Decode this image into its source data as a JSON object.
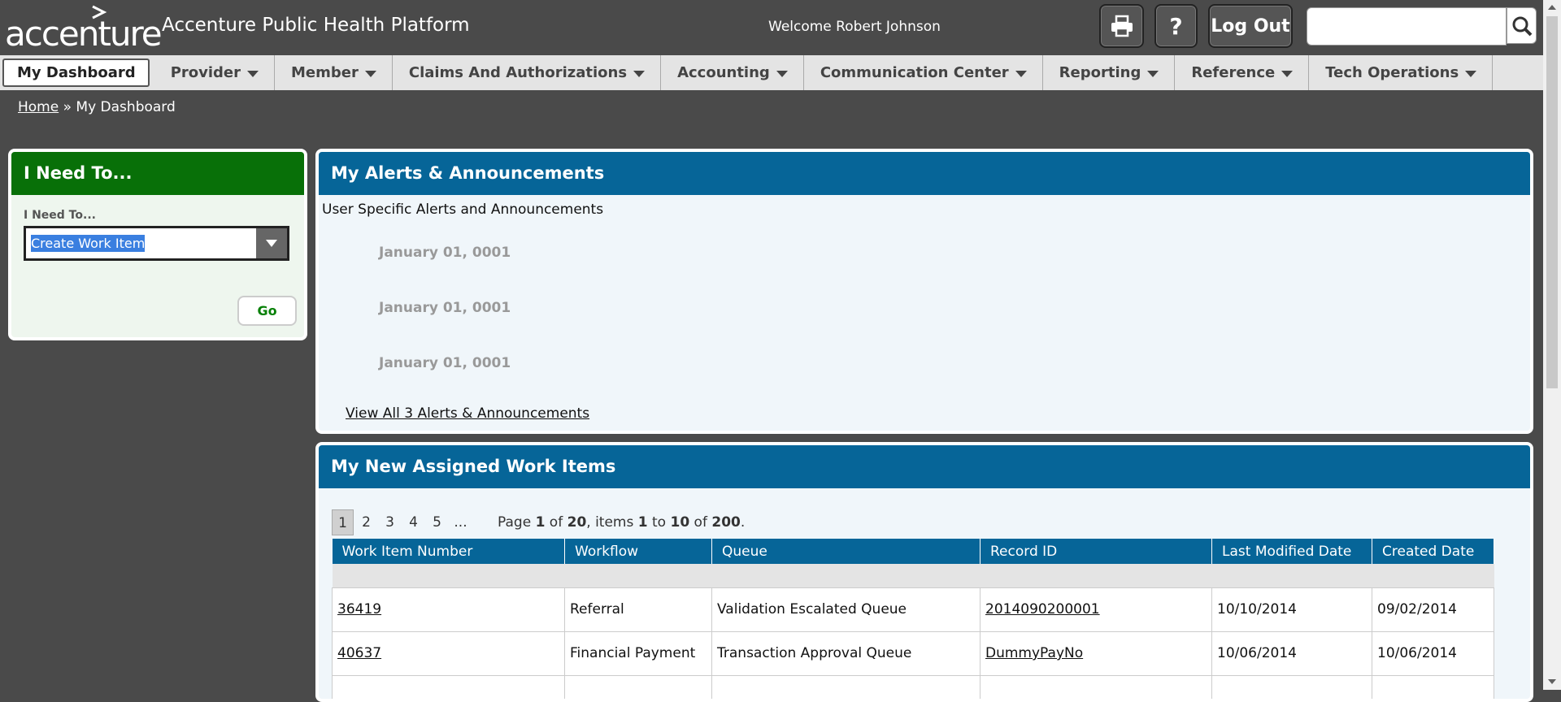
{
  "header": {
    "logo_text": "accenture",
    "app_title": "Accenture Public Health Platform",
    "welcome": "Welcome Robert Johnson",
    "print_icon": "printer-icon",
    "help_label": "?",
    "logout_label": "Log Out",
    "search_placeholder": "",
    "search_icon": "search-icon"
  },
  "nav": {
    "items": [
      {
        "label": "My Dashboard",
        "dropdown": false
      },
      {
        "label": "Provider",
        "dropdown": true
      },
      {
        "label": "Member",
        "dropdown": true
      },
      {
        "label": "Claims And Authorizations",
        "dropdown": true
      },
      {
        "label": "Accounting",
        "dropdown": true
      },
      {
        "label": "Communication Center",
        "dropdown": true
      },
      {
        "label": "Reporting",
        "dropdown": true
      },
      {
        "label": "Reference",
        "dropdown": true
      },
      {
        "label": "Tech Operations",
        "dropdown": true
      }
    ]
  },
  "breadcrumb": {
    "home": "Home",
    "separator": "»",
    "current": "My Dashboard"
  },
  "need_to": {
    "title": "I Need To...",
    "field_label": "I Need To...",
    "selected": "Create Work Item",
    "go_label": "Go",
    "colors": {
      "header": "#087008"
    }
  },
  "alerts": {
    "title": "My Alerts & Announcements",
    "subtitle": "User Specific Alerts and Announcements",
    "dates": [
      "January 01, 0001",
      "January 01, 0001",
      "January 01, 0001"
    ],
    "view_all": "View All 3 Alerts & Announcements",
    "colors": {
      "header": "#066598"
    }
  },
  "work_items": {
    "title": "My New Assigned Work Items",
    "pages": [
      "1",
      "2",
      "3",
      "4",
      "5",
      "..."
    ],
    "current_page": "1",
    "page_info": {
      "prefix": "Page ",
      "page": "1",
      "of1": " of ",
      "total_pages": "20",
      "items": ", items ",
      "from": "1",
      "to_word": " to ",
      "to": "10",
      "of2": " of ",
      "total_items": "200",
      "suffix": "."
    },
    "columns": [
      "Work Item Number",
      "Workflow",
      "Queue",
      "Record ID",
      "Last Modified Date",
      "Created Date"
    ],
    "rows": [
      [
        "36419",
        "Referral",
        "Validation Escalated Queue",
        "2014090200001",
        "10/10/2014",
        "09/02/2014"
      ],
      [
        "40637",
        "Financial Payment",
        "Transaction Approval Queue",
        "DummyPayNo",
        "10/06/2014",
        "10/06/2014"
      ],
      [
        "",
        "",
        "",
        "",
        "",
        ""
      ]
    ]
  }
}
